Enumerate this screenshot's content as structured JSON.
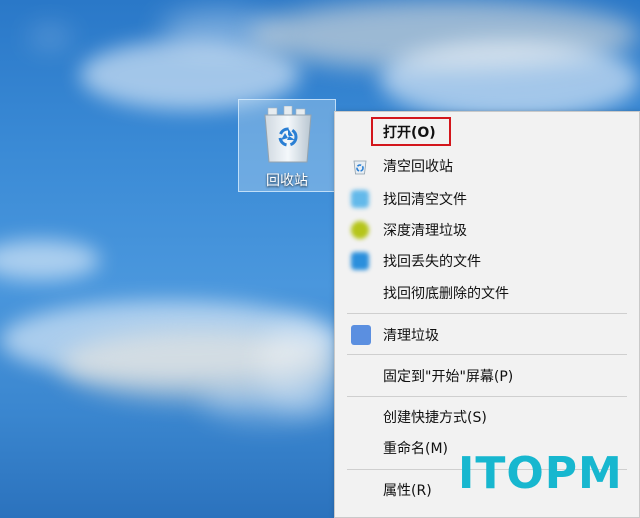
{
  "desktop": {
    "recycle_bin": {
      "label": "回收站",
      "icon": "recycle-bin-icon"
    }
  },
  "context_menu": {
    "items": [
      {
        "label": "打开(O)",
        "icon": null
      },
      {
        "label": "清空回收站",
        "icon": "recycle-small-icon"
      },
      {
        "label": "找回清空文件",
        "icon": "app-blurred-icon"
      },
      {
        "label": "深度清理垃圾",
        "icon": "app-blurred-icon"
      },
      {
        "label": "找回丢失的文件",
        "icon": "app-blurred-icon"
      },
      {
        "label": "找回彻底删除的文件",
        "icon": null
      },
      {
        "label": "清理垃圾",
        "icon": "app-blurred-icon"
      },
      {
        "label": "固定到\"开始\"屏幕(P)",
        "icon": null
      },
      {
        "label": "创建快捷方式(S)",
        "icon": null
      },
      {
        "label": "重命名(M)",
        "icon": null
      },
      {
        "label": "属性(R)",
        "icon": null
      }
    ]
  },
  "watermark": {
    "text": "ITOPM"
  },
  "colors": {
    "highlight_border": "#d3161c",
    "watermark": "#17b7cf",
    "menu_background": "#f2f2f2"
  }
}
